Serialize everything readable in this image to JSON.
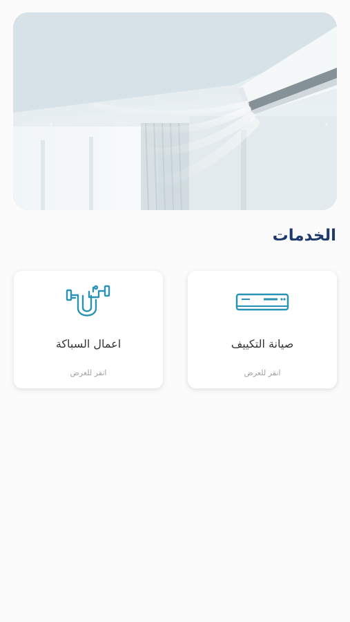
{
  "hero": {
    "prev_arrow": "‹",
    "next_arrow": "›"
  },
  "section": {
    "title": "الخدمات"
  },
  "services": [
    {
      "title": "صيانة التكييف",
      "hint": "انقر للعرض",
      "icon": "air-conditioner-icon"
    },
    {
      "title": "اعمال السباكة",
      "hint": "انقر للعرض",
      "icon": "plumbing-pipe-icon"
    }
  ],
  "colors": {
    "title": "#1d3a6e",
    "icon_accent": "#2a93b5",
    "card_background": "#ffffff",
    "page_background": "#fbfbfb"
  }
}
